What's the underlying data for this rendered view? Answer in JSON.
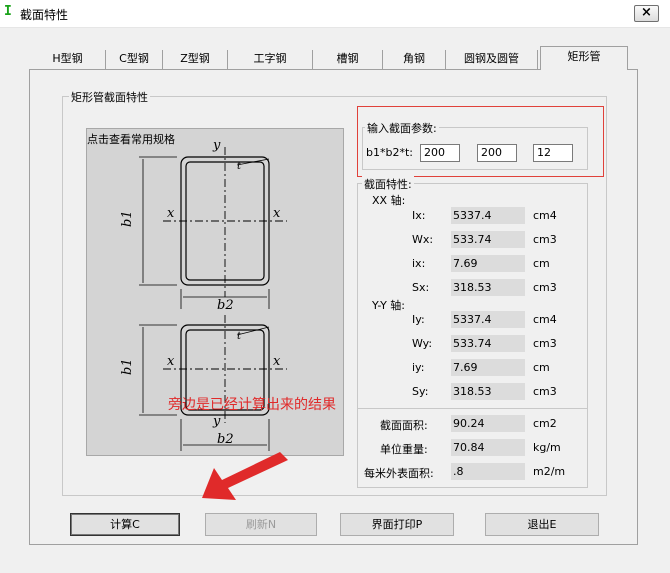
{
  "window": {
    "icon": "I",
    "title": "截面特性",
    "close_symbol": "×"
  },
  "tabs": [
    {
      "label": "H型钢",
      "active": false
    },
    {
      "label": "C型钢",
      "active": false
    },
    {
      "label": "Z型钢",
      "active": false
    },
    {
      "label": "工字钢",
      "active": false
    },
    {
      "label": "槽钢",
      "active": false
    },
    {
      "label": "角钢",
      "active": false
    },
    {
      "label": "圆钢及圆管",
      "active": false
    },
    {
      "label": "矩形管",
      "active": true
    }
  ],
  "section_group": {
    "title": "矩形管截面特性",
    "diagram_hint": "点击查看常用规格",
    "diagram_labels": {
      "y": "y",
      "x": "x",
      "t": "t",
      "b1": "b1",
      "b2": "b2"
    }
  },
  "input_group": {
    "title": "输入截面参数:",
    "label": "b1*b2*t:",
    "b1": "200",
    "b2": "200",
    "t": "12"
  },
  "props_group": {
    "title": "截面特性:",
    "xx_axis": "XX 轴:",
    "yy_axis": "Y-Y 轴:",
    "xx_rows": [
      {
        "name": "Ix:",
        "value": "5337.4",
        "unit": "cm4"
      },
      {
        "name": "Wx:",
        "value": "533.74",
        "unit": "cm3"
      },
      {
        "name": "ix:",
        "value": "7.69",
        "unit": "cm"
      },
      {
        "name": "Sx:",
        "value": "318.53",
        "unit": "cm3"
      }
    ],
    "yy_rows": [
      {
        "name": "Iy:",
        "value": "5337.4",
        "unit": "cm4"
      },
      {
        "name": "Wy:",
        "value": "533.74",
        "unit": "cm3"
      },
      {
        "name": "iy:",
        "value": "7.69",
        "unit": "cm"
      },
      {
        "name": "Sy:",
        "value": "318.53",
        "unit": "cm3"
      }
    ],
    "extra_rows": [
      {
        "name": "截面面积:",
        "value": "90.24",
        "unit": "cm2"
      },
      {
        "name": "单位重量:",
        "value": "70.84",
        "unit": "kg/m"
      },
      {
        "name": "每米外表面积:",
        "value": ".8",
        "unit": "m2/m"
      }
    ]
  },
  "buttons": {
    "calc": "计算C",
    "refresh": "刷新N",
    "print": "界面打印P",
    "exit": "退出E"
  },
  "annotation": "旁边是已经计算出来的结果",
  "colors": {
    "annotation": "#e02a2a",
    "app_icon": "#1aa31a"
  }
}
